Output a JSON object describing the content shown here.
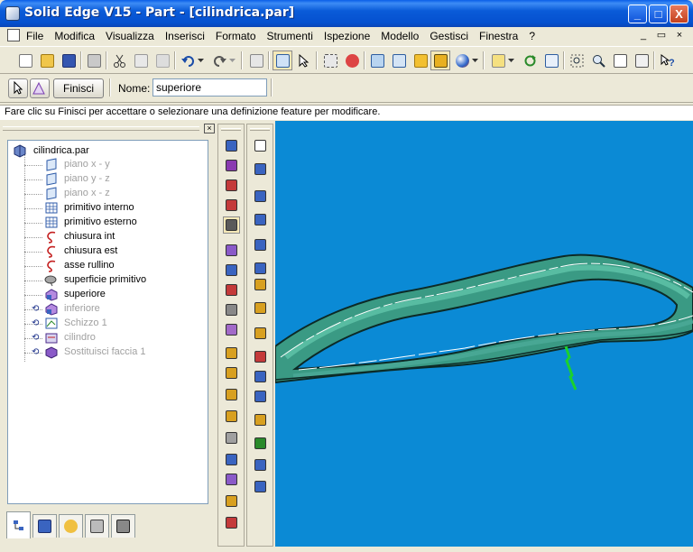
{
  "window": {
    "title": "Solid Edge V15 - Part - [cilindrica.par]",
    "controls": [
      "_",
      "□",
      "X"
    ]
  },
  "menu": {
    "items": [
      "File",
      "Modifica",
      "Visualizza",
      "Inserisci",
      "Formato",
      "Strumenti",
      "Ispezione",
      "Modello",
      "Gestisci",
      "Finestra",
      "?"
    ],
    "mdi_controls": [
      "_",
      "▭",
      "×"
    ]
  },
  "ribbon": {
    "finish_label": "Finisci",
    "name_label": "Nome:",
    "name_value": "superiore"
  },
  "prompt": "Fare clic su Finisci per accettare o selezionare una definizione feature per modificare.",
  "pathfinder": {
    "close": "×",
    "root": "cilindrica.par",
    "items": [
      {
        "label": "piano x - y",
        "icon": "reference-plane-icon",
        "dim": true,
        "rollback": false
      },
      {
        "label": "piano y - z",
        "icon": "reference-plane-icon",
        "dim": true,
        "rollback": false
      },
      {
        "label": "piano x - z",
        "icon": "reference-plane-icon",
        "dim": true,
        "rollback": false
      },
      {
        "label": "primitivo interno",
        "icon": "primitive-icon",
        "dim": false,
        "rollback": false
      },
      {
        "label": "primitivo esterno",
        "icon": "primitive-icon",
        "dim": false,
        "rollback": false
      },
      {
        "label": "chiusura int",
        "icon": "curve-icon",
        "dim": false,
        "rollback": false
      },
      {
        "label": "chiusura est",
        "icon": "curve-icon",
        "dim": false,
        "rollback": false
      },
      {
        "label": "asse rullino",
        "icon": "curve-icon",
        "dim": false,
        "rollback": false
      },
      {
        "label": "superficie primitivo",
        "icon": "surface-icon",
        "dim": false,
        "rollback": false
      },
      {
        "label": "superiore",
        "icon": "surface-feature-icon",
        "dim": false,
        "rollback": false
      },
      {
        "label": "inferiore",
        "icon": "surface-feature-icon",
        "dim": true,
        "rollback": true
      },
      {
        "label": "Schizzo 1",
        "icon": "sketch-icon",
        "dim": true,
        "rollback": true
      },
      {
        "label": "cilindro",
        "icon": "cylinder-feature-icon",
        "dim": true,
        "rollback": true
      },
      {
        "label": "Sostituisci faccia 1",
        "icon": "replace-face-icon",
        "dim": true,
        "rollback": true
      }
    ],
    "tabs": [
      "feature-pathfinder-icon",
      "library-icon",
      "layers-icon",
      "sensors-icon",
      "family-icon"
    ]
  },
  "colors": {
    "viewport_bg": "#0b8ad5",
    "model_fill": "#3a9a84",
    "model_edge": "#0c2a26",
    "highlight": "#1bd12e",
    "title_bar": "#0550cf"
  }
}
